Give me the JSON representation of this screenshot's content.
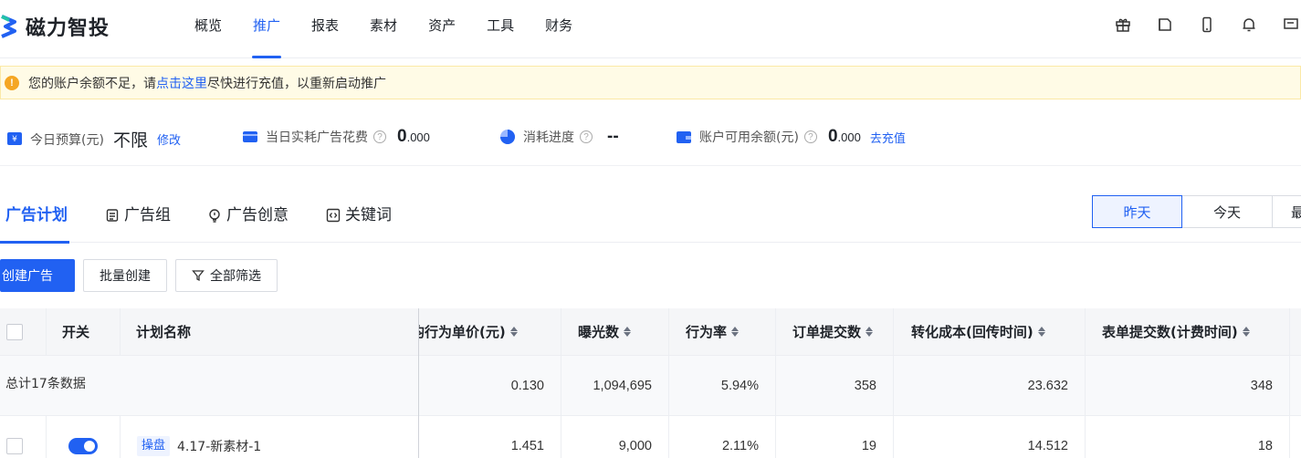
{
  "app": {
    "logo_text": "磁力智投"
  },
  "nav": {
    "items": [
      {
        "label": "概览",
        "active": false
      },
      {
        "label": "推广",
        "active": true
      },
      {
        "label": "报表",
        "active": false
      },
      {
        "label": "素材",
        "active": false
      },
      {
        "label": "资产",
        "active": false
      },
      {
        "label": "工具",
        "active": false
      },
      {
        "label": "财务",
        "active": false
      }
    ],
    "icons": [
      "gift-icon",
      "book-icon",
      "mobile-icon",
      "bell-icon",
      "message-icon"
    ]
  },
  "alert": {
    "text_before": "您的账户余额不足，请",
    "link": "点击这里",
    "text_after": "尽快进行充值，以重新启动推广"
  },
  "stats": {
    "budget": {
      "label": "今日预算(元)",
      "value": "不限",
      "link": "修改"
    },
    "spend": {
      "label": "当日实耗广告花费",
      "value_int": "0",
      "value_dec": ".000"
    },
    "progress": {
      "label": "消耗进度",
      "value": "--"
    },
    "balance": {
      "label": "账户可用余额(元)",
      "value_int": "0",
      "value_dec": ".000",
      "link": "去充值"
    }
  },
  "tabs": [
    {
      "label": "广告计划",
      "active": true
    },
    {
      "label": "广告组",
      "active": false,
      "icon": "group-icon"
    },
    {
      "label": "广告创意",
      "active": false,
      "icon": "bulb-icon"
    },
    {
      "label": "关键词",
      "active": false,
      "icon": "keyword-icon"
    }
  ],
  "date_tabs": [
    {
      "label": "昨天",
      "active": true
    },
    {
      "label": "今天",
      "active": false
    },
    {
      "label": "最",
      "active": false
    }
  ],
  "toolbar": {
    "create_label": "创建广告",
    "batch_label": "批量创建",
    "filter_label": "全部筛选"
  },
  "table": {
    "headers": {
      "switch": "开关",
      "name": "计划名称",
      "unit_price": "均行为单价(元)",
      "impressions": "曝光数",
      "action_rate": "行为率",
      "orders": "订单提交数",
      "conv_cost": "转化成本(回传时间)",
      "forms": "表单提交数(计费时间)"
    },
    "total": {
      "label": "总计17条数据",
      "unit_price": "0.130",
      "impressions": "1,094,695",
      "action_rate": "5.94%",
      "orders": "358",
      "conv_cost": "23.632",
      "forms": "348"
    },
    "rows": [
      {
        "switch_on": true,
        "tag": "操盘",
        "name": "4.17-新素材-1",
        "unit_price": "1.451",
        "impressions": "9,000",
        "action_rate": "2.11%",
        "orders": "19",
        "conv_cost": "14.512",
        "forms": "18"
      }
    ]
  },
  "colors": {
    "primary": "#2161f2",
    "alert_bg": "#fffbe6",
    "alert_icon": "#f5a623"
  }
}
